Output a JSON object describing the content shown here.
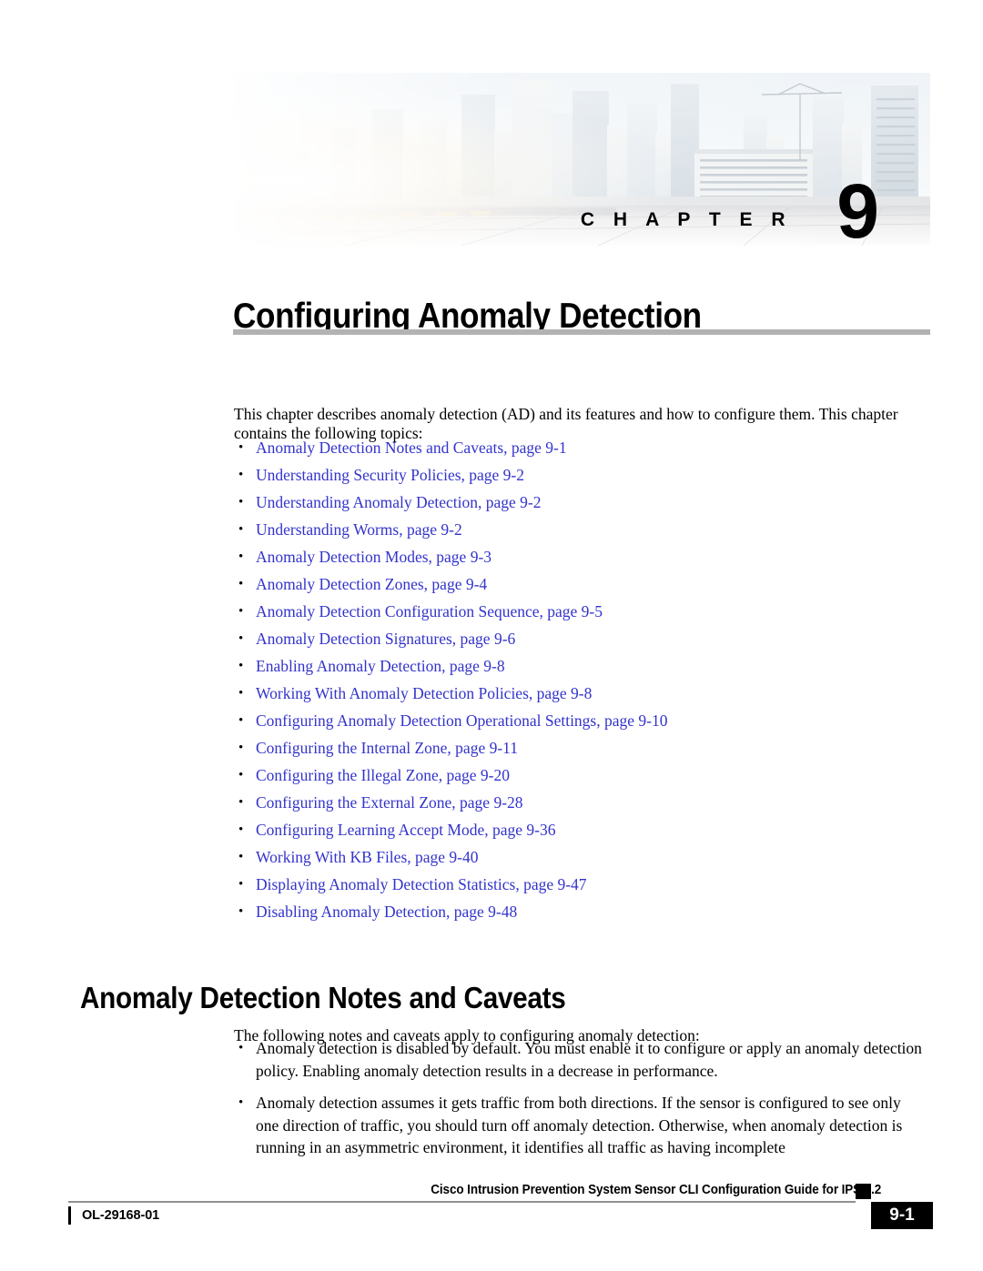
{
  "banner": {
    "chapter_word": "C H A P T E R",
    "chapter_number": "9",
    "art_description": "city-skyline-photo"
  },
  "chapter": {
    "title": "Configuring Anomaly Detection"
  },
  "intro": {
    "paragraph": "This chapter describes anomaly detection (AD) and its features and how to configure them. This chapter contains the following topics:"
  },
  "toc": {
    "items": [
      {
        "label": "Anomaly Detection Notes and Caveats, page 9-1"
      },
      {
        "label": "Understanding Security Policies, page 9-2"
      },
      {
        "label": "Understanding Anomaly Detection, page 9-2"
      },
      {
        "label": "Understanding Worms, page 9-2"
      },
      {
        "label": "Anomaly Detection Modes, page 9-3"
      },
      {
        "label": "Anomaly Detection Zones, page 9-4"
      },
      {
        "label": "Anomaly Detection Configuration Sequence, page 9-5"
      },
      {
        "label": "Anomaly Detection Signatures, page 9-6"
      },
      {
        "label": "Enabling Anomaly Detection, page 9-8"
      },
      {
        "label": "Working With Anomaly Detection Policies, page 9-8"
      },
      {
        "label": "Configuring Anomaly Detection Operational Settings, page 9-10"
      },
      {
        "label": "Configuring the Internal Zone, page 9-11"
      },
      {
        "label": "Configuring the Illegal Zone, page 9-20"
      },
      {
        "label": "Configuring the External Zone, page 9-28"
      },
      {
        "label": "Configuring Learning Accept Mode, page 9-36"
      },
      {
        "label": "Working With KB Files, page 9-40"
      },
      {
        "label": "Displaying Anomaly Detection Statistics, page 9-47"
      },
      {
        "label": "Disabling Anomaly Detection, page 9-48"
      }
    ],
    "link_color": "#3333CC"
  },
  "section": {
    "heading": "Anomaly Detection Notes and Caveats",
    "intro": "The following notes and caveats apply to configuring anomaly detection:",
    "bullets": [
      "Anomaly detection is disabled by default. You must enable it to configure or apply an anomaly detection policy. Enabling anomaly detection results in a decrease in performance.",
      "Anomaly detection assumes it gets traffic from both directions. If the sensor is configured to see only one direction of traffic, you should turn off anomaly detection. Otherwise, when anomaly detection is running in an asymmetric environment, it identifies all traffic as having incomplete"
    ]
  },
  "footer": {
    "doc_id": "OL-29168-01",
    "guide_title": "Cisco Intrusion Prevention System Sensor CLI Configuration Guide for IPS 7.2",
    "page_number": "9-1"
  }
}
